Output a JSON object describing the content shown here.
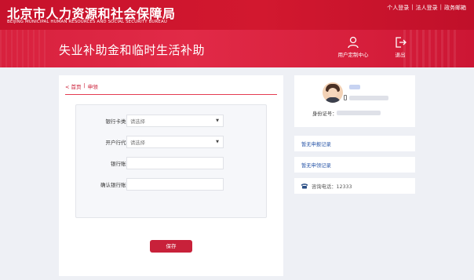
{
  "header": {
    "org_name_cn": "北京市人力资源和社会保障局",
    "org_name_en": "BEIJING MUNICIPAL HUMAN RESOURCES AND SOCIAL SECURITY BUREAU",
    "top_links": [
      "个人登录",
      "法人登录",
      "政务邮箱"
    ],
    "top_link_separator": "|",
    "page_title": "失业补助金和临时生活补助",
    "user_center_label": "用户定制中心",
    "exit_label": "退出",
    "colors": {
      "primary_red": "#c9142e",
      "banner_red": "#e12a47"
    }
  },
  "breadcrumb": {
    "home": "< 首页",
    "separator": "|",
    "current": "申领"
  },
  "form": {
    "fields": [
      {
        "label": "银行卡类型",
        "type": "select",
        "value": "请选择"
      },
      {
        "label": "开户行代码",
        "type": "select",
        "value": "请选择"
      },
      {
        "label": "银行账号",
        "type": "text",
        "value": ""
      },
      {
        "label": "确认银行账号",
        "type": "text",
        "value": ""
      }
    ],
    "save_label": "保存"
  },
  "sidebar": {
    "id_label": "身份证号：",
    "records": [
      "暂无申报记录",
      "暂无申领记录"
    ],
    "hotline": "咨询电话：12333",
    "icons": {
      "avatar": "user-avatar",
      "phone": "mobile-phone-icon",
      "hotline": "telephone-icon"
    }
  }
}
